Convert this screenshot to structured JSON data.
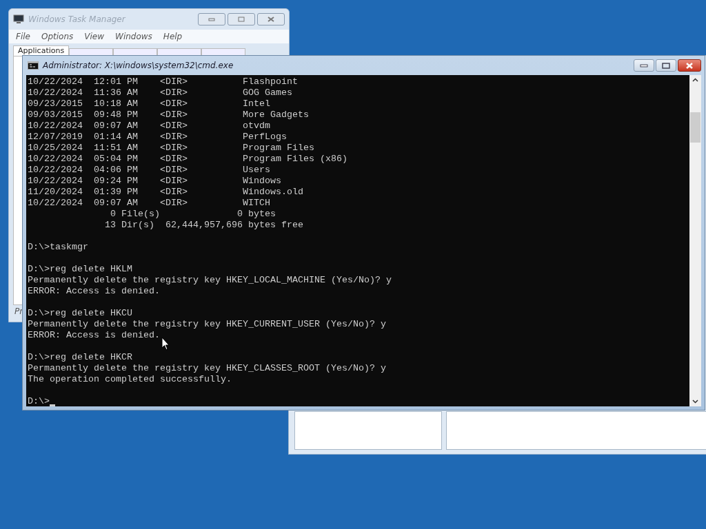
{
  "task_manager": {
    "title": "Windows Task Manager",
    "menu": [
      "File",
      "Options",
      "View",
      "Windows",
      "Help"
    ],
    "tabs": [
      {
        "label": "Applications",
        "selected": true
      },
      {
        "selected": false
      },
      {
        "selected": false
      },
      {
        "selected": false
      },
      {
        "selected": false
      }
    ],
    "status_text": "Pr"
  },
  "console": {
    "title": "Administrator: X:\\windows\\system32\\cmd.exe",
    "cursor": true,
    "blocks": [
      [
        "10/22/2024  12:01 PM    <DIR>          Flashpoint",
        "10/22/2024  11:36 AM    <DIR>          GOG Games",
        "09/23/2015  10:18 AM    <DIR>          Intel",
        "09/03/2015  09:48 PM    <DIR>          More Gadgets",
        "10/22/2024  09:07 AM    <DIR>          otvdm",
        "12/07/2019  01:14 AM    <DIR>          PerfLogs",
        "10/25/2024  11:51 AM    <DIR>          Program Files",
        "10/22/2024  05:04 PM    <DIR>          Program Files (x86)",
        "10/22/2024  04:06 PM    <DIR>          Users",
        "10/22/2024  09:24 PM    <DIR>          Windows",
        "11/20/2024  01:39 PM    <DIR>          Windows.old",
        "10/22/2024  09:07 AM    <DIR>          WITCH",
        "               0 File(s)              0 bytes",
        "              13 Dir(s)  62,444,957,696 bytes free"
      ],
      [
        "D:\\>taskmgr"
      ],
      [
        "D:\\>reg delete HKLM",
        "Permanently delete the registry key HKEY_LOCAL_MACHINE (Yes/No)? y",
        "ERROR: Access is denied."
      ],
      [
        "D:\\>reg delete HKCU",
        "Permanently delete the registry key HKEY_CURRENT_USER (Yes/No)? y",
        "ERROR: Access is denied."
      ],
      [
        "D:\\>reg delete HKCR",
        "Permanently delete the registry key HKEY_CLASSES_ROOT (Yes/No)? y",
        "The operation completed successfully."
      ],
      [
        "D:\\>"
      ]
    ]
  }
}
